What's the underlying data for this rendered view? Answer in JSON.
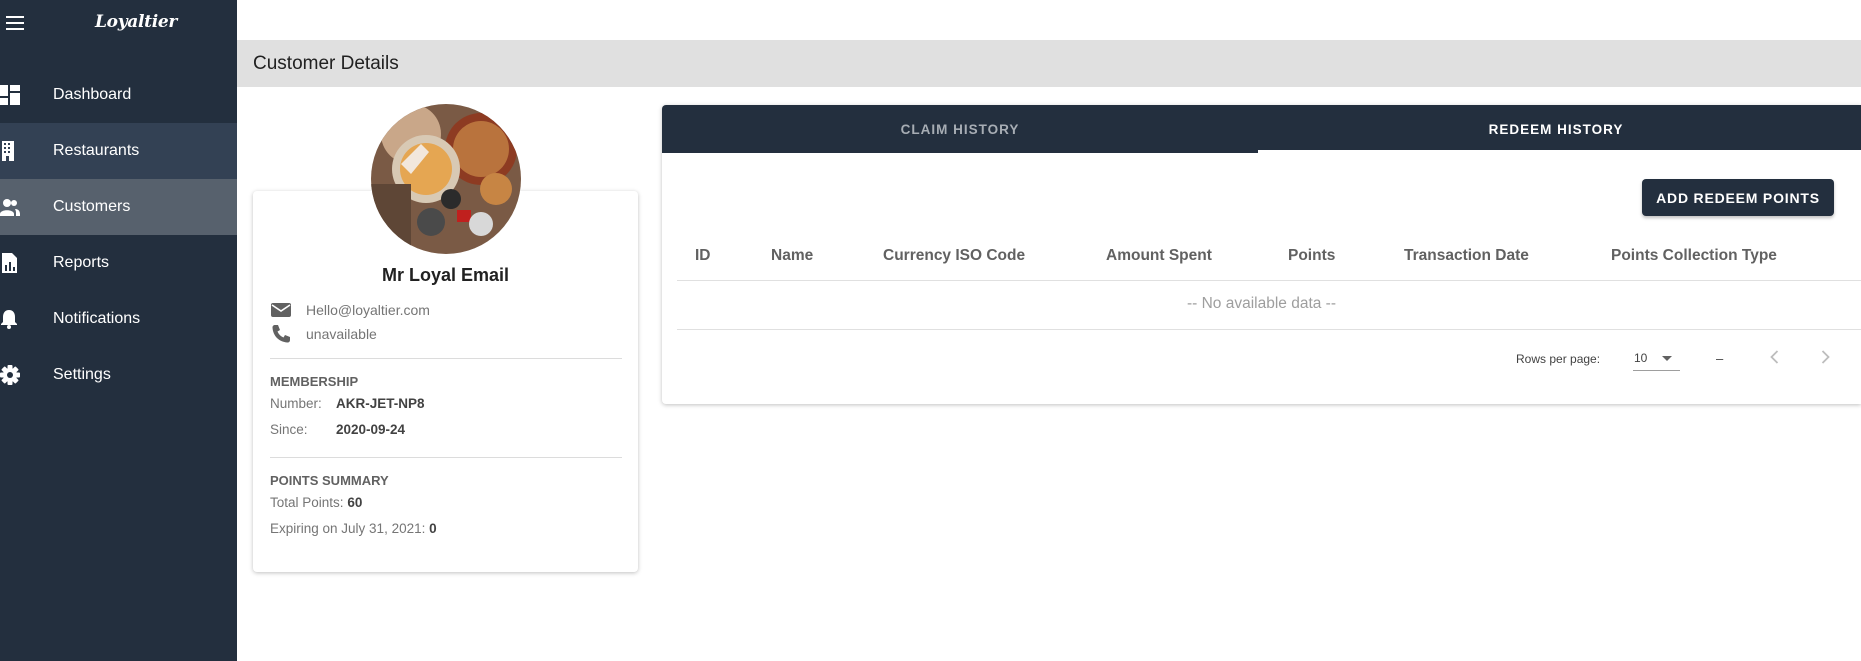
{
  "app": {
    "logo": "Loyaltier"
  },
  "sidebar": {
    "items": [
      {
        "label": "Dashboard",
        "icon": "dashboard-icon"
      },
      {
        "label": "Restaurants",
        "icon": "building-icon"
      },
      {
        "label": "Customers",
        "icon": "people-icon"
      },
      {
        "label": "Reports",
        "icon": "report-icon"
      },
      {
        "label": "Notifications",
        "icon": "bell-icon"
      },
      {
        "label": "Settings",
        "icon": "gear-icon"
      }
    ]
  },
  "page": {
    "title": "Customer Details"
  },
  "customer": {
    "name": "Mr Loyal Email",
    "email": "Hello@loyaltier.com",
    "phone": "unavailable",
    "membership": {
      "title": "MEMBERSHIP",
      "number_label": "Number:",
      "number": "AKR-JET-NP8",
      "since_label": "Since:",
      "since": "2020-09-24"
    },
    "points": {
      "title": "POINTS SUMMARY",
      "total_label": "Total Points:",
      "total": "60",
      "expiring_label": "Expiring on July 31, 2021:",
      "expiring": "0"
    }
  },
  "tabs": [
    {
      "label": "CLAIM HISTORY"
    },
    {
      "label": "REDEEM HISTORY"
    }
  ],
  "table": {
    "add_button": "ADD REDEEM POINTS",
    "columns": [
      "ID",
      "Name",
      "Currency ISO Code",
      "Amount Spent",
      "Points",
      "Transaction Date",
      "Points Collection Type"
    ],
    "empty_text": "-- No available data --",
    "pagination": {
      "rows_per_page_label": "Rows per page:",
      "rows_per_page": "10",
      "range": "–"
    }
  },
  "colors": {
    "sidebar": "#232f3e",
    "active_item": "#57616d",
    "accent": "#232f3e"
  }
}
